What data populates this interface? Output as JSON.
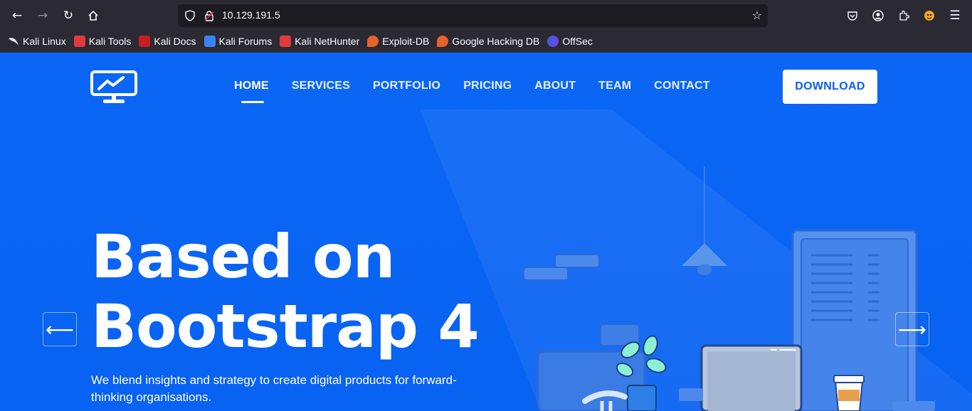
{
  "browser": {
    "url": "10.129.191.5",
    "bookmarks": [
      {
        "label": "Kali Linux",
        "icon": "kali-dragon-icon"
      },
      {
        "label": "Kali Tools",
        "icon": "kali-tools-icon"
      },
      {
        "label": "Kali Docs",
        "icon": "kali-docs-icon"
      },
      {
        "label": "Kali Forums",
        "icon": "kali-forums-icon"
      },
      {
        "label": "Kali NetHunter",
        "icon": "kali-nethunter-icon"
      },
      {
        "label": "Exploit-DB",
        "icon": "exploit-db-icon"
      },
      {
        "label": "Google Hacking DB",
        "icon": "ghdb-icon"
      },
      {
        "label": "OffSec",
        "icon": "offsec-icon"
      }
    ]
  },
  "site": {
    "nav": [
      "HOME",
      "SERVICES",
      "PORTFOLIO",
      "PRICING",
      "ABOUT",
      "TEAM",
      "CONTACT"
    ],
    "active_nav": "HOME",
    "download_label": "DOWNLOAD",
    "hero": {
      "title_line1": "Based on",
      "title_line2": "Bootstrap 4",
      "subtitle": "We blend insights and strategy to create digital products for forward-thinking organisations."
    },
    "prev_arrow": "⟵",
    "next_arrow": "⟶"
  },
  "colors": {
    "brand_blue": "#0a64f5",
    "chrome_bg": "#2b2a33",
    "urlbar_bg": "#1c1b22"
  }
}
